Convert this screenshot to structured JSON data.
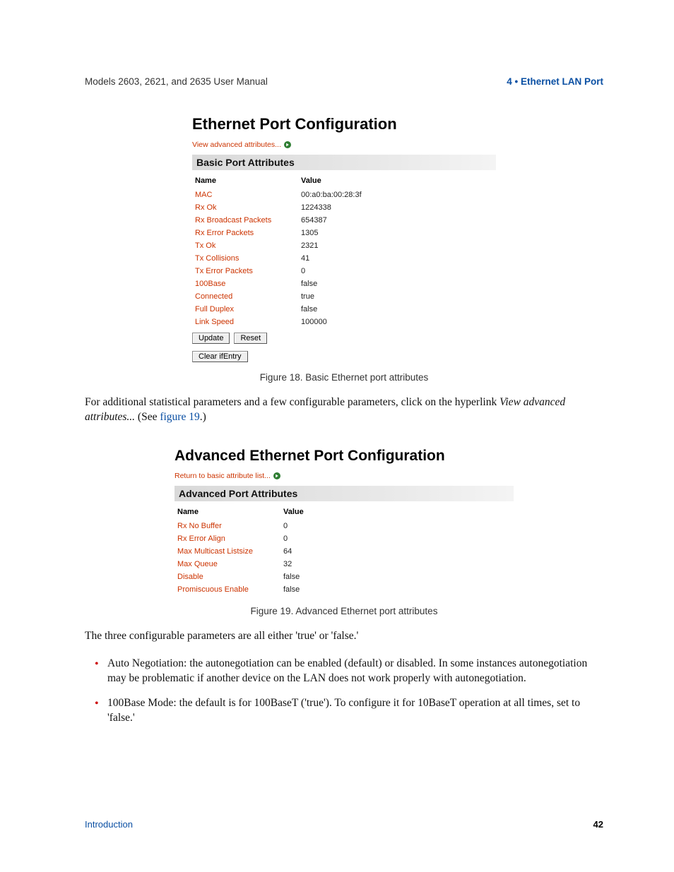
{
  "header": {
    "left": "Models 2603, 2621, and 2635 User Manual",
    "right": "4 • Ethernet LAN Port"
  },
  "figure18": {
    "title": "Ethernet Port Configuration",
    "link": "View advanced attributes...",
    "section_label": "Basic Port Attributes",
    "col_name": "Name",
    "col_value": "Value",
    "rows": [
      {
        "name": "MAC",
        "value": "00:a0:ba:00:28:3f"
      },
      {
        "name": "Rx Ok",
        "value": "1224338"
      },
      {
        "name": "Rx Broadcast Packets",
        "value": "654387"
      },
      {
        "name": "Rx Error Packets",
        "value": "1305"
      },
      {
        "name": "Tx Ok",
        "value": "2321"
      },
      {
        "name": "Tx Collisions",
        "value": "41"
      },
      {
        "name": "Tx Error Packets",
        "value": "0"
      },
      {
        "name": "100Base",
        "value": "false"
      },
      {
        "name": "Connected",
        "value": "true"
      },
      {
        "name": "Full Duplex",
        "value": "false"
      },
      {
        "name": "Link Speed",
        "value": "100000"
      }
    ],
    "buttons": {
      "update": "Update",
      "reset": "Reset",
      "clear": "Clear ifEntry"
    },
    "caption": "Figure 18. Basic Ethernet port attributes"
  },
  "para1": {
    "prefix": "For additional statistical parameters and a few configurable parameters, click on the hyperlink ",
    "em": "View advanced attributes...",
    "mid": " (See ",
    "xref": "figure 19",
    "suffix": ".)"
  },
  "figure19": {
    "title": "Advanced Ethernet Port Configuration",
    "link": "Return to basic attribute list...",
    "section_label": "Advanced Port Attributes",
    "col_name": "Name",
    "col_value": "Value",
    "rows": [
      {
        "name": "Rx No Buffer",
        "value": "0"
      },
      {
        "name": "Rx Error Align",
        "value": "0"
      },
      {
        "name": "Max Multicast Listsize",
        "value": "64"
      },
      {
        "name": "Max Queue",
        "value": "32"
      },
      {
        "name": "Disable",
        "value": "false"
      },
      {
        "name": "Promiscuous Enable",
        "value": "false"
      }
    ],
    "caption": "Figure 19. Advanced Ethernet port attributes"
  },
  "para2": "The three configurable parameters are all either 'true' or 'false.'",
  "bullets": [
    "Auto Negotiation: the autonegotiation can be enabled (default) or disabled. In some instances autonegotiation may be problematic if another device on the LAN does not work properly with autonegotiation.",
    "100Base Mode: the default is for 100BaseT ('true'). To configure it for 10BaseT operation at all times, set to 'false.'"
  ],
  "footer": {
    "left": "Introduction",
    "right": "42"
  }
}
